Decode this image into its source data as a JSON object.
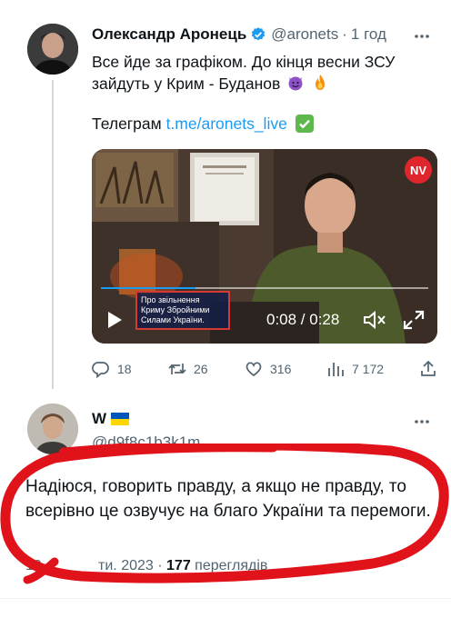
{
  "tweet": {
    "author_name": "Олександр Аронець",
    "author_handle": "@aronets",
    "separator": "·",
    "time": "1 год",
    "text_line": "Все йде за графіком. До кінця весни ЗСУ зайдуть у Крим - Буданов",
    "emojis": [
      "devil-emoji",
      "fire-emoji"
    ],
    "telegram_label": "Телеграм",
    "telegram_link": "t.me/aronets_live",
    "video": {
      "badge": "NV",
      "caption": "Про звільнення Криму Збройними Силами України.",
      "time_display": "0:08 / 0:28",
      "progress": 0.29
    },
    "actions": {
      "replies": "18",
      "retweets": "26",
      "likes": "316",
      "views": "7 172"
    }
  },
  "reply": {
    "author_name": "W",
    "author_handle": "@d9f8c1b3k1m",
    "text": "Надіюся, говорить правду, а якщо не правду, то всерівно це озвучує на благо України та перемоги.",
    "date": "10.",
    "date_tail": "             ти. 2023 ·",
    "views_count": "177",
    "views_label": "переглядів"
  },
  "colors": {
    "accent": "#1d9bf0",
    "secondary_text": "#536471",
    "annotation_red": "#e0121a"
  }
}
